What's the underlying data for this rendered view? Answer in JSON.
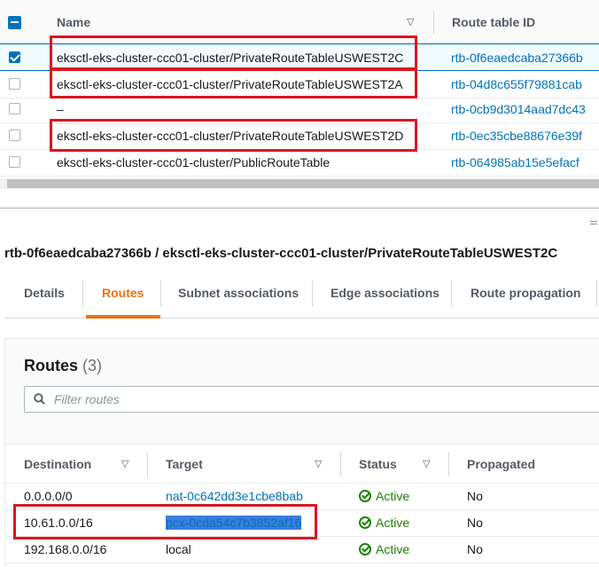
{
  "route_tables": {
    "header": {
      "name": "Name",
      "route_table_id": "Route table ID"
    },
    "rows": [
      {
        "name": "eksctl-eks-cluster-ccc01-cluster/PrivateRouteTableUSWEST2C",
        "id": "rtb-0f6eaedcaba27366b",
        "checked": true
      },
      {
        "name": "eksctl-eks-cluster-ccc01-cluster/PrivateRouteTableUSWEST2A",
        "id": "rtb-04d8c655f79881cab",
        "checked": false
      },
      {
        "name": "–",
        "id": "rtb-0cb9d3014aad7dc43",
        "checked": false
      },
      {
        "name": "eksctl-eks-cluster-ccc01-cluster/PrivateRouteTableUSWEST2D",
        "id": "rtb-0ec35cbe88676e39f",
        "checked": false
      },
      {
        "name": "eksctl-eks-cluster-ccc01-cluster/PublicRouteTable",
        "id": "rtb-064985ab15e5efacf",
        "checked": false
      }
    ]
  },
  "detail": {
    "title": "rtb-0f6eaedcaba27366b / eksctl-eks-cluster-ccc01-cluster/PrivateRouteTableUSWEST2C",
    "tabs": [
      "Details",
      "Routes",
      "Subnet associations",
      "Edge associations",
      "Route propagation"
    ],
    "active_tab": "Routes"
  },
  "routes": {
    "title": "Routes",
    "count": "(3)",
    "filter_placeholder": "Filter routes",
    "columns": {
      "destination": "Destination",
      "target": "Target",
      "status": "Status",
      "propagated": "Propagated"
    },
    "rows": [
      {
        "destination": "0.0.0.0/0",
        "target": "nat-0c642dd3e1cbe8bab",
        "status": "Active",
        "propagated": "No"
      },
      {
        "destination": "10.61.0.0/16",
        "target": "pcx-0cda54c7b3852af16",
        "status": "Active",
        "propagated": "No"
      },
      {
        "destination": "192.168.0.0/16",
        "target": "local",
        "status": "Active",
        "propagated": "No"
      }
    ]
  },
  "colors": {
    "link": "#0073bb",
    "active_tab": "#ec7211",
    "status_ok": "#1d8102",
    "highlight_box": "#d9181f",
    "selection": "#3b7ddd"
  },
  "icons": [
    "select-all-checkbox-icon",
    "sort-caret-icon",
    "checkbox-icon",
    "search-icon",
    "status-active-icon",
    "resize-handle-icon"
  ]
}
